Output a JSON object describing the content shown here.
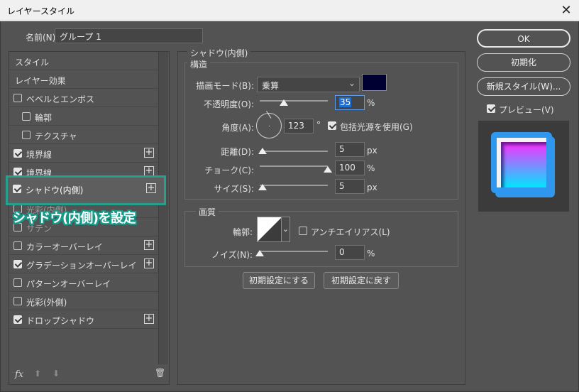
{
  "window": {
    "title": "レイヤースタイル",
    "close_glyph": "✕"
  },
  "name_label": "名前(N):",
  "name_value": "グループ 1",
  "styles_list": [
    {
      "label": "スタイル",
      "checkbox": null,
      "plus": false,
      "indent": 0
    },
    {
      "label": "レイヤー効果",
      "checkbox": null,
      "plus": false,
      "indent": 0
    },
    {
      "label": "ベベルとエンボス",
      "checkbox": false,
      "plus": false,
      "indent": 0
    },
    {
      "label": "輪郭",
      "checkbox": false,
      "plus": false,
      "indent": 1
    },
    {
      "label": "テクスチャ",
      "checkbox": false,
      "plus": false,
      "indent": 1
    },
    {
      "label": "境界線",
      "checkbox": true,
      "plus": true,
      "indent": 0
    },
    {
      "label": "境界線",
      "checkbox": true,
      "plus": true,
      "indent": 0
    },
    {
      "label": "シャドウ(内側)",
      "checkbox": true,
      "plus": true,
      "indent": 0,
      "highlighted": true
    },
    {
      "label": "光彩(内側)",
      "checkbox": false,
      "plus": false,
      "indent": 0,
      "obscured": true
    },
    {
      "label": "サテン",
      "checkbox": false,
      "plus": false,
      "indent": 0,
      "obscured": true
    },
    {
      "label": "カラーオーバーレイ",
      "checkbox": false,
      "plus": true,
      "indent": 0
    },
    {
      "label": "グラデーションオーバーレイ",
      "checkbox": true,
      "plus": true,
      "indent": 0
    },
    {
      "label": "パターンオーバーレイ",
      "checkbox": false,
      "plus": false,
      "indent": 0
    },
    {
      "label": "光彩(外側)",
      "checkbox": false,
      "plus": false,
      "indent": 0
    },
    {
      "label": "ドロップシャドウ",
      "checkbox": true,
      "plus": true,
      "indent": 0
    }
  ],
  "callout": "シャドウ(内側)を設定",
  "list_footer": {
    "fx": "fx",
    "up": "⬆",
    "down": "⬇",
    "trash": "🗑"
  },
  "panel": {
    "title": "シャドウ(内側)",
    "structure_title": "構造",
    "blend_mode_label": "描画モード(B):",
    "blend_mode_value": "乗算",
    "shadow_color": "#000033",
    "opacity_label": "不透明度(O):",
    "opacity_value": "35",
    "angle_label": "角度(A):",
    "angle_value": "123",
    "angle_unit": "°",
    "global_light_label": "包括光源を使用(G)",
    "global_light_checked": true,
    "distance_label": "距離(D):",
    "distance_value": "5",
    "choke_label": "チョーク(C):",
    "choke_value": "100",
    "size_label": "サイズ(S):",
    "size_value": "5",
    "unit_percent": "%",
    "unit_px": "px",
    "quality_title": "画質",
    "contour_label": "輪郭:",
    "antialias_label": "アンチエイリアス(L)",
    "antialias_checked": false,
    "noise_label": "ノイズ(N):",
    "noise_value": "0",
    "make_default_button": "初期設定にする",
    "reset_default_button": "初期設定に戻す"
  },
  "buttons": {
    "ok": "OK",
    "reset": "初期化",
    "new_style": "新規スタイル(W)...",
    "preview_label": "プレビュー(V)",
    "preview_checked": true
  },
  "preview_colors": {
    "gradient_top": "#ff2cff",
    "gradient_bottom": "#00e6ff",
    "frame": "#2f98ee"
  }
}
